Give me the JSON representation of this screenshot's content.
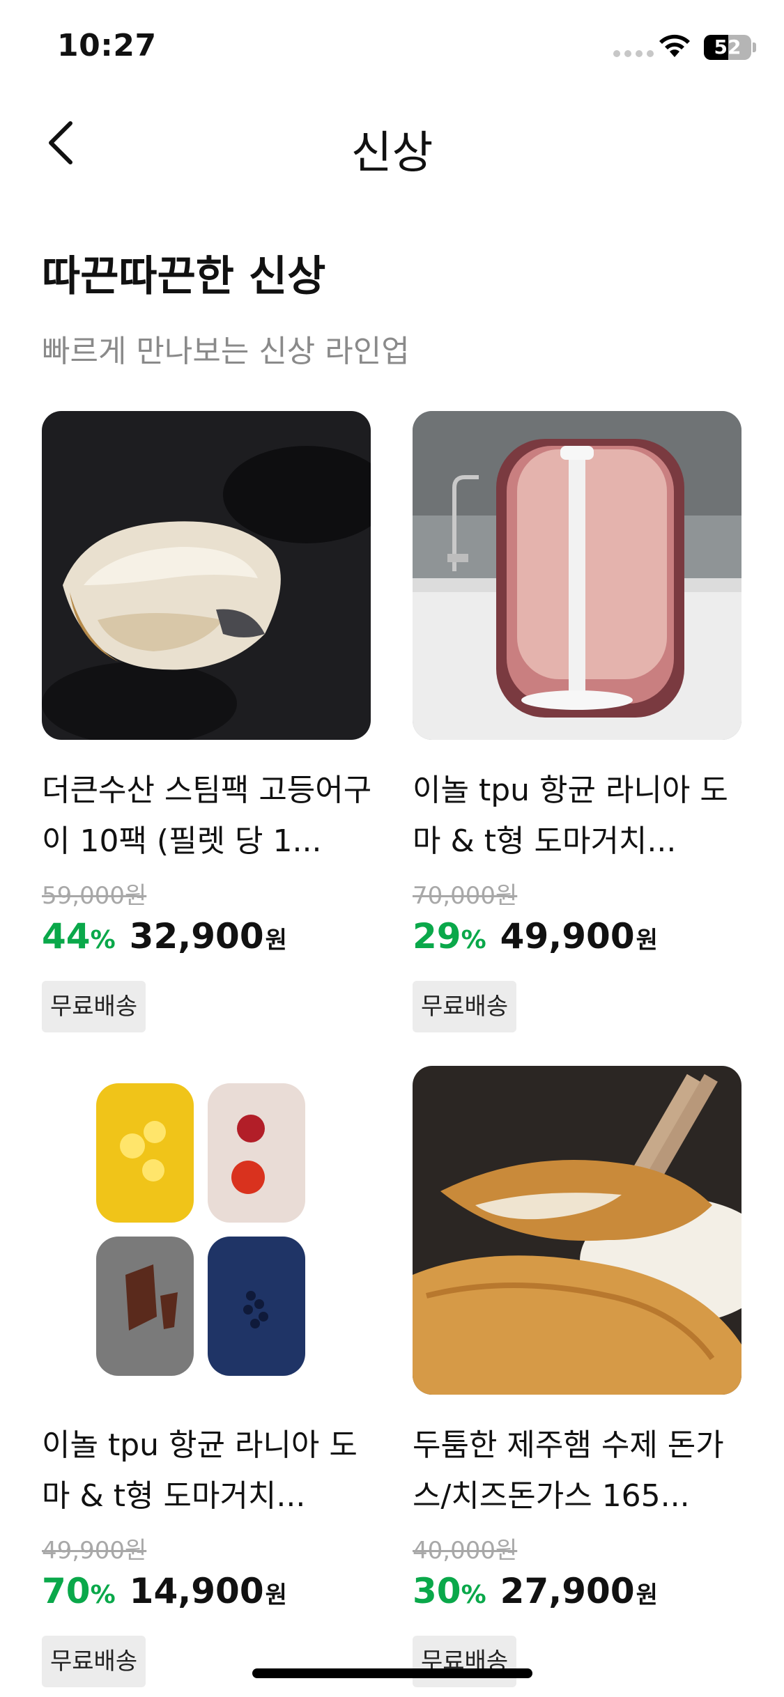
{
  "status_bar": {
    "time": "10:27",
    "battery": "52"
  },
  "nav": {
    "title": "신상"
  },
  "section": {
    "title": "따끈따끈한 신상",
    "subtitle": "빠르게 만나보는 신상 라인업"
  },
  "products": [
    {
      "name": "더큰수산 스팀팩 고등어구이 10팩 (필렛 당 1...",
      "original_price": "59,000원",
      "discount": "44",
      "discount_unit": "%",
      "price": "32,900",
      "price_unit": "원",
      "badge": "무료배송"
    },
    {
      "name": "이놀 tpu 항균 라니아 도마 & t형 도마거치...",
      "original_price": "70,000원",
      "discount": "29",
      "discount_unit": "%",
      "price": "49,900",
      "price_unit": "원",
      "badge": "무료배송"
    },
    {
      "name": "이놀 tpu 항균 라니아 도마 & t형 도마거치...",
      "original_price": "49,900원",
      "discount": "70",
      "discount_unit": "%",
      "price": "14,900",
      "price_unit": "원",
      "badge": "무료배송"
    },
    {
      "name": "두툼한 제주햄 수제 돈가스/치즈돈가스 165...",
      "original_price": "40,000원",
      "discount": "30",
      "discount_unit": "%",
      "price": "27,900",
      "price_unit": "원",
      "badge": "무료배송"
    }
  ],
  "colors": {
    "discount": "#0aa84a",
    "badge_bg": "#ececec",
    "subtitle": "#8a8a8a"
  },
  "icons": {
    "back": "chevron-left-icon",
    "wifi": "wifi-icon",
    "signal": "cellular-signal-icon",
    "battery": "battery-icon"
  }
}
